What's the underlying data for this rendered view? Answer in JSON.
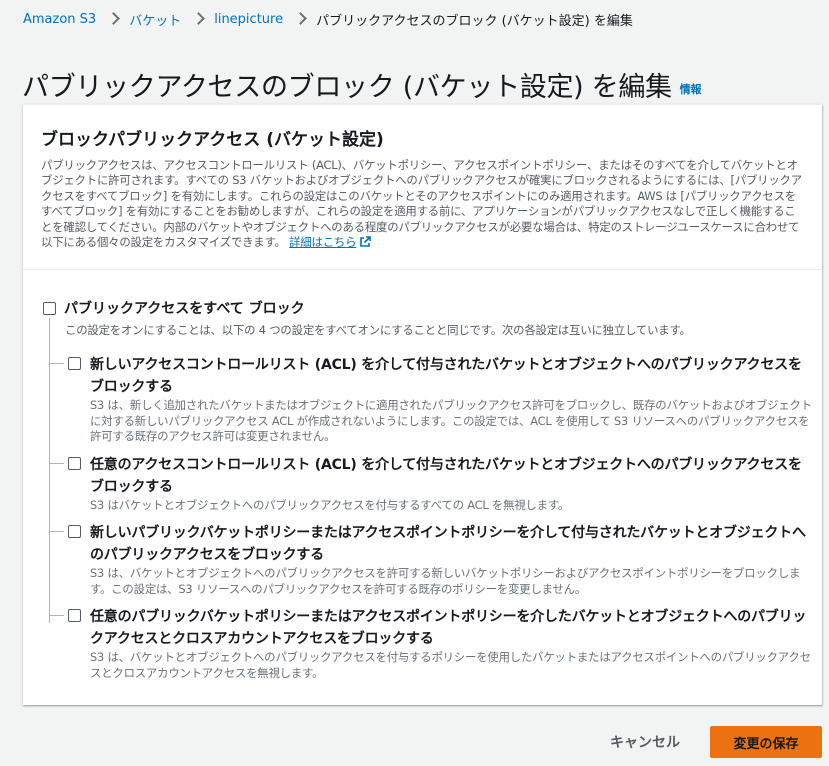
{
  "breadcrumb": {
    "items": [
      "Amazon S3",
      "バケット",
      "linepicture"
    ],
    "current": "パブリックアクセスのブロック (バケット設定) を編集"
  },
  "page": {
    "title": "パブリックアクセスのブロック (バケット設定) を編集",
    "info_label": "情報"
  },
  "panel": {
    "title": "ブロックパブリックアクセス (バケット設定)",
    "description": "パブリックアクセスは、アクセスコントロールリスト (ACL)、バケットポリシー、アクセスポイントポリシー、またはそのすべてを介してバケットとオブジェクトに許可されます。すべての S3 バケットおよびオブジェクトへのパブリックアクセスが確実にブロックされるようにするには、[パブリックアクセスをすべてブロック] を有効にします。これらの設定はこのバケットとそのアクセスポイントにのみ適用されます。AWS は [パブリックアクセスをすべてブロック] を有効にすることをお勧めしますが、これらの設定を適用する前に、アプリケーションがパブリックアクセスなしで正しく機能することを確認してください。内部のバケットやオブジェクトへのある程度のパブリックアクセスが必要な場合は、特定のストレージユースケースに合わせて以下にある個々の設定をカスタマイズできます。",
    "learn_more": "詳細はこちら"
  },
  "block_all": {
    "label": "パブリックアクセスをすべて ブロック",
    "description": "この設定をオンにすることは、以下の 4 つの設定をすべてオンにすることと同じです。次の各設定は互いに独立しています。",
    "checked": false
  },
  "options": [
    {
      "label": "新しいアクセスコントロールリスト (ACL) を介して付与されたバケットとオブジェクトへのパブリックアクセスをブロックする",
      "description": "S3 は、新しく追加されたバケットまたはオブジェクトに適用されたパブリックアクセス許可をブロックし、既存のバケットおよびオブジェクトに対する新しいパブリックアクセス ACL が作成されないようにします。この設定では、ACL を使用して S3 リソースへのパブリックアクセスを許可する既存のアクセス許可は変更されません。",
      "checked": false
    },
    {
      "label": "任意のアクセスコントロールリスト (ACL) を介して付与されたバケットとオブジェクトへのパブリックアクセスをブロックする",
      "description": "S3 はバケットとオブジェクトへのパブリックアクセスを付与するすべての ACL を無視します。",
      "checked": false
    },
    {
      "label": "新しいパブリックバケットポリシーまたはアクセスポイントポリシーを介して付与されたバケットとオブジェクトへのパブリックアクセスをブロックする",
      "description": "S3 は、バケットとオブジェクトへのパブリックアクセスを許可する新しいバケットポリシーおよびアクセスポイントポリシーをブロックします。この設定は、S3 リソースへのパブリックアクセスを許可する既存のポリシーを変更しません。",
      "checked": false
    },
    {
      "label": "任意のパブリックバケットポリシーまたはアクセスポイントポリシーを介したバケットとオブジェクトへのパブリックアクセスとクロスアカウントアクセスをブロックする",
      "description": "S3 は、バケットとオブジェクトへのパブリックアクセスを付与するポリシーを使用したバケットまたはアクセスポイントへのパブリックアクセスとクロスアカウントアクセスを無視します。",
      "checked": false
    }
  ],
  "footer": {
    "cancel_label": "キャンセル",
    "save_label": "変更の保存"
  },
  "colors": {
    "primary_button": "#ec7211",
    "link": "#0073bb",
    "background": "#f2f3f3"
  }
}
